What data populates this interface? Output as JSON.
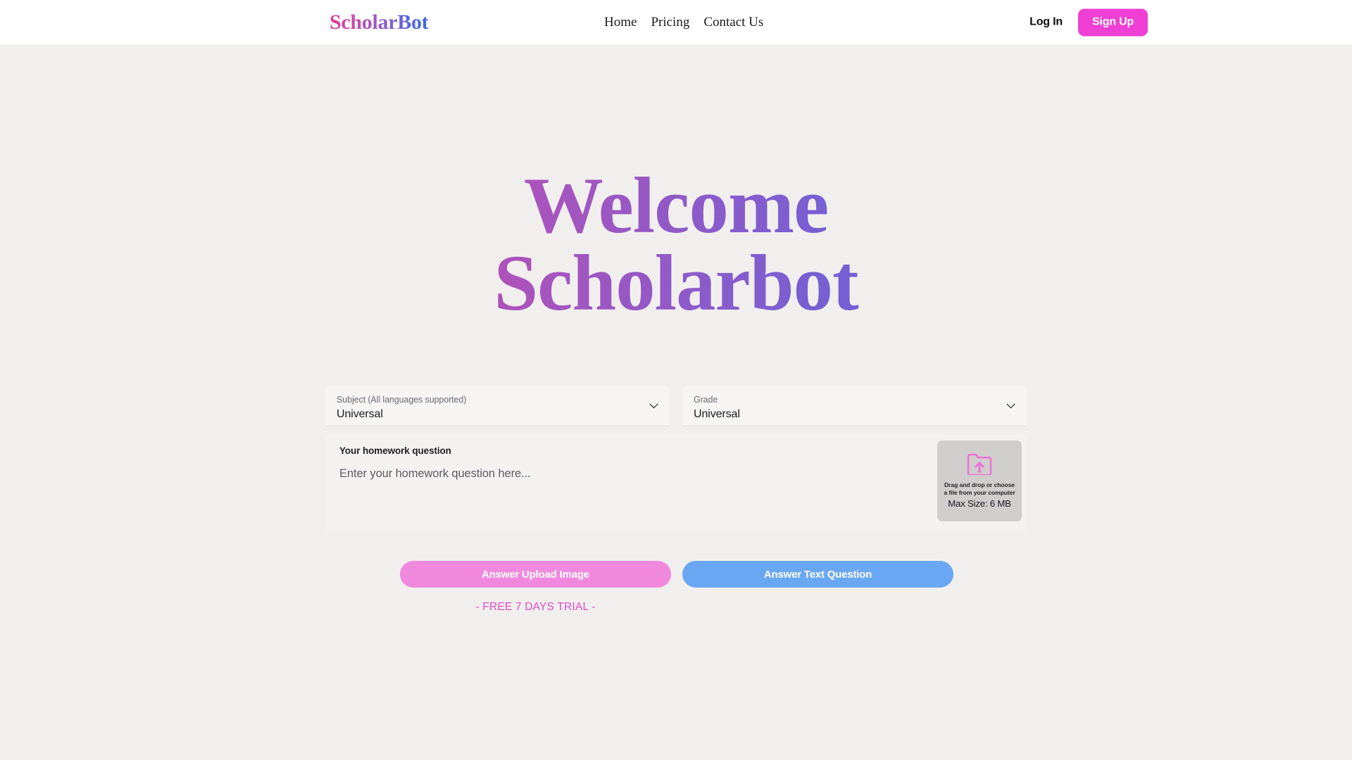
{
  "header": {
    "brand": "ScholarBot",
    "nav": [
      {
        "label": "Home"
      },
      {
        "label": "Pricing"
      },
      {
        "label": "Contact Us"
      }
    ],
    "login_label": "Log In",
    "signup_label": "Sign Up",
    "icons": {
      "brand": "scholarbot-wordmark"
    },
    "colors": {
      "signup_bg": "#ef3fd4",
      "header_bg": "#ffffff",
      "brand_gradient_from": "#e03a96",
      "brand_gradient_to": "#3f68e4"
    }
  },
  "hero": {
    "line1": "Welcome",
    "line2": "Scholarbot",
    "gradient_from": "#e8318f",
    "gradient_to": "#386fe8"
  },
  "form": {
    "subject": {
      "label": "Subject (All languages supported)",
      "value": "Universal",
      "icon": "chevron-down-icon"
    },
    "grade": {
      "label": "Grade",
      "value": "Universal",
      "icon": "chevron-down-icon"
    },
    "question": {
      "label": "Your homework question",
      "value": "",
      "placeholder": "Enter your homework question here..."
    },
    "dropzone": {
      "icon": "folder-upload-icon",
      "hint": "Drag and drop or choose a file from your computer",
      "max_size": "Max Size: 6 MB",
      "icon_color": "#f06cd8",
      "bg_color": "#d0cdcd"
    }
  },
  "actions": {
    "upload_label": "Answer Upload Image",
    "text_label": "Answer Text Question",
    "upload_color": "#f089de",
    "text_color": "#6aa7f3",
    "trial_note": "- FREE 7 DAYS TRIAL -",
    "trial_color": "#e04bc7"
  },
  "page": {
    "background": "#f1efee"
  }
}
